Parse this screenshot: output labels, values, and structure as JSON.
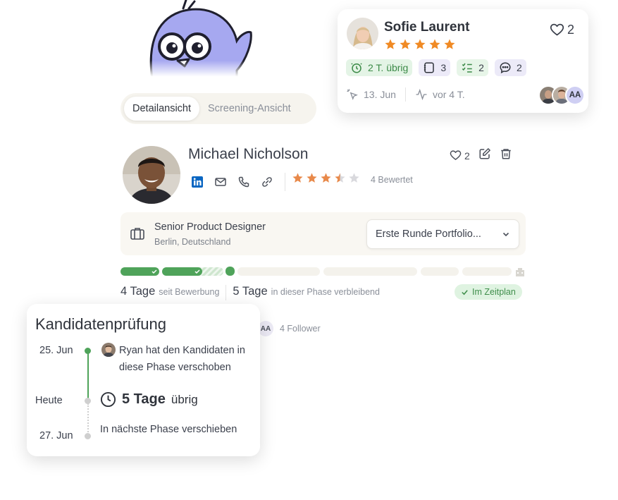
{
  "tabs": [
    {
      "label": "Detailansicht",
      "active": true
    },
    {
      "label": "Screening-Ansicht",
      "active": false
    }
  ],
  "candidate": {
    "name": "Michael Nicholson",
    "likes": "2",
    "rating": 3.5,
    "rating_label": "4 Bewertet",
    "job_title": "Senior Product Designer",
    "job_location": "Berlin, Deutschland",
    "stage": "Erste Runde Portfolio...",
    "days_applied": "4 Tage",
    "days_applied_label": "seit Bewerbung",
    "days_left": "5 Tage",
    "days_left_label": "in dieser Phase verbleibend",
    "status": "Im Zeitplan",
    "follower_initials": "AA",
    "followers": "4 Follower"
  },
  "review_card": {
    "name": "Sofie Laurent",
    "stars": 5,
    "likes": "2",
    "chips": [
      {
        "icon": "clock-icon",
        "value": "2 T. übrig"
      },
      {
        "icon": "notes-icon",
        "value": "3"
      },
      {
        "icon": "checklist-icon",
        "value": "2"
      },
      {
        "icon": "comment-icon",
        "value": "2"
      }
    ],
    "date": "13. Jun",
    "activity": "vor 4 T.",
    "avatar_initials": "AA"
  },
  "timeline_card": {
    "title": "Kandidatenprüfung",
    "events": [
      {
        "date": "25. Jun",
        "text": "Ryan hat den Kandidaten in diese Phase verschoben"
      },
      {
        "date": "Heute",
        "days": "5 Tage",
        "days_label": "übrig"
      },
      {
        "date": "27. Jun",
        "text": "In nächste Phase verschieben"
      }
    ]
  },
  "colors": {
    "accent_green": "#4fa35a",
    "star_orange": "#e8894a",
    "star_gold": "#f08a24",
    "lavender": "#cfcff3"
  }
}
